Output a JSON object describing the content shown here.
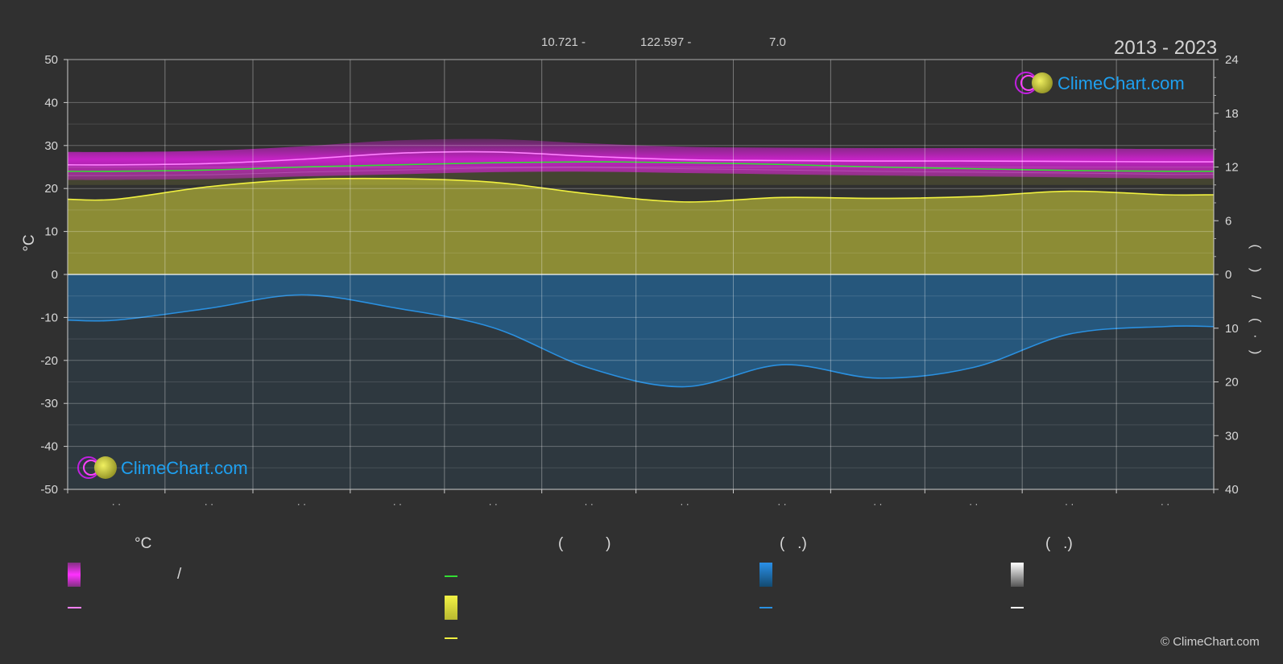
{
  "header": {
    "lat": "10.721 -",
    "lon": "122.597 -",
    "elev": "7.0",
    "period": "2013 - 2023"
  },
  "logo": {
    "text": "ClimeChart.com"
  },
  "copyright": "© ClimeChart.com",
  "colors": {
    "background": "#303030",
    "temp_range": "#e020e0",
    "sunshine": "#d8d83a",
    "precip": "#1e7fc8",
    "mean_line": "#33dd33",
    "precip_line": "#2a90e0",
    "sun_line": "#f0f040",
    "max_line": "#ff80ff"
  },
  "legend": {
    "col1_head": "°C",
    "col1_slash": "/",
    "col2_head": "(          )",
    "col3_head": "(   .)",
    "col4_head": "(   .)"
  },
  "chart_data": {
    "type": "area",
    "months": 12,
    "x_tick_labels": [
      "· ·",
      "· ·",
      "· ·",
      "· ·",
      "· ·",
      "· ·",
      "· ·",
      "· ·",
      "· ·",
      "· ·",
      "· ·",
      "· ·"
    ],
    "ylabel_left": "°C",
    "ylabel_right": "(     )      /     (   ·   )",
    "ylim_left": [
      -50,
      50
    ],
    "yticks_left": [
      50,
      40,
      30,
      20,
      10,
      0,
      -10,
      -20,
      -30,
      -40,
      -50
    ],
    "yticks_right_top": [
      24,
      18,
      12,
      6,
      0
    ],
    "yticks_right_bottom": [
      10,
      20,
      30,
      40
    ],
    "series": [
      {
        "key": "max_temp",
        "values": [
          25.5,
          25.8,
          26.8,
          28.2,
          28.5,
          27.5,
          26.7,
          26.5,
          26.4,
          26.4,
          26.3,
          26.2
        ]
      },
      {
        "key": "mean_temp",
        "values": [
          24.0,
          24.3,
          25.0,
          25.5,
          26.0,
          26.2,
          26.0,
          25.6,
          25.0,
          24.6,
          24.2,
          24.0
        ]
      },
      {
        "key": "min_temp",
        "values": [
          23.0,
          23.2,
          23.8,
          24.3,
          24.8,
          24.9,
          24.6,
          24.3,
          24.0,
          23.8,
          23.6,
          23.3
        ]
      },
      {
        "key": "sunshine_hours",
        "values": [
          8.4,
          9.8,
          10.6,
          10.7,
          10.3,
          9.0,
          8.1,
          8.6,
          8.5,
          8.7,
          9.3,
          8.9
        ]
      },
      {
        "key": "precipitation_mm_per_day",
        "values": [
          8.5,
          6.3,
          3.8,
          6.3,
          9.9,
          17.4,
          20.9,
          16.8,
          19.3,
          17.3,
          11.1,
          9.7
        ]
      }
    ]
  }
}
